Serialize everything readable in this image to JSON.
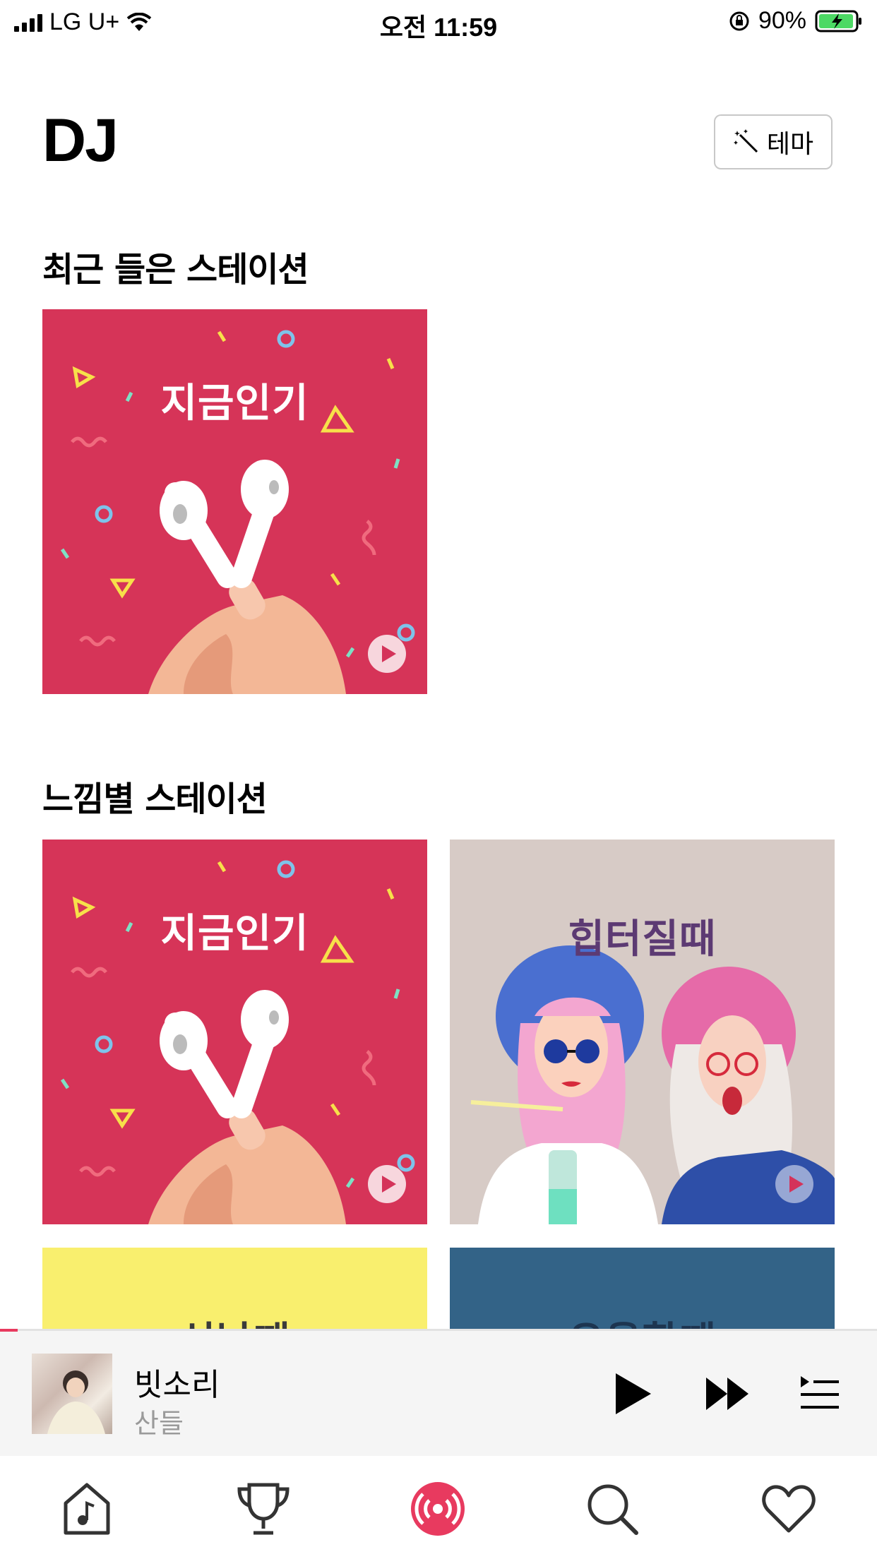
{
  "status_bar": {
    "carrier": "LG U+",
    "time": "오전 11:59",
    "battery": "90%"
  },
  "header": {
    "title": "DJ",
    "theme_button_label": "테마"
  },
  "recent_section": {
    "title": "최근 들은 스테이션",
    "items": [
      {
        "label": "지금인기",
        "bg": "#d63458"
      }
    ]
  },
  "mood_section": {
    "title": "느낌별 스테이션",
    "items": [
      {
        "label": "지금인기",
        "bg": "#d63458"
      },
      {
        "label": "힙터질때",
        "bg": "#d7cbc6"
      },
      {
        "label": "신날때",
        "bg": "#f9ef6e"
      },
      {
        "label": "우울할때",
        "bg": "#336387"
      }
    ]
  },
  "now_playing": {
    "song": "빗소리",
    "artist": "산들",
    "progress": 0.02
  },
  "tabs": [
    {
      "name": "home",
      "icon": "music-house-icon"
    },
    {
      "name": "chart",
      "icon": "trophy-icon"
    },
    {
      "name": "dj",
      "icon": "radio-broadcast-icon",
      "active": true
    },
    {
      "name": "search",
      "icon": "search-icon"
    },
    {
      "name": "favorites",
      "icon": "heart-icon"
    }
  ],
  "colors": {
    "accent": "#e83a5f"
  }
}
